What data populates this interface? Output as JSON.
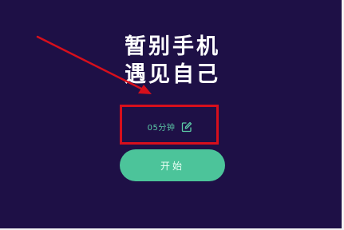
{
  "screen": {
    "background_color": "#1e1046",
    "accent_color": "#4cc49a",
    "annotation_color": "#d60f1c"
  },
  "headline": {
    "line1": "暂别手机",
    "line2": "遇见自己"
  },
  "duration": {
    "label": "05分钟",
    "icon": "edit-icon"
  },
  "start_button": {
    "label": "开始"
  }
}
